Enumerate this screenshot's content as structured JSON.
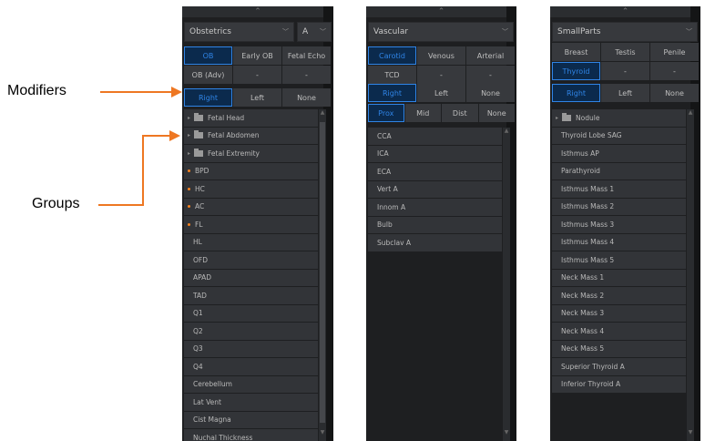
{
  "annotations": {
    "modifiers": "Modifiers",
    "groups": "Groups"
  },
  "colors": {
    "accent_blue": "#2f84e6",
    "arrow_orange": "#ee7722",
    "dot_orange": "#f5821f",
    "panel_bg": "#1e1f21"
  },
  "icons": {
    "collapse_up": "⌃",
    "collapse_side": "«",
    "scroll_up": "▲",
    "scroll_down": "▼",
    "caret": "▸"
  },
  "panel1": {
    "exam": "Obstetrics",
    "side_select": "A",
    "row1": [
      "OB",
      "Early OB",
      "Fetal Echo"
    ],
    "row2": [
      "OB (Adv)",
      "-",
      "-"
    ],
    "modifiers": [
      "Right",
      "Left",
      "None"
    ],
    "groups": [
      "Fetal Head",
      "Fetal Abdomen",
      "Fetal Extremity"
    ],
    "items_dot": [
      "BPD",
      "HC",
      "AC",
      "FL"
    ],
    "items": [
      "HL",
      "OFD",
      "APAD",
      "TAD",
      "Q1",
      "Q2",
      "Q3",
      "Q4",
      "Cerebellum",
      "Lat Vent",
      "Cist Magna",
      "Nuchal Thickness"
    ]
  },
  "panel2": {
    "exam": "Vascular",
    "row1": [
      "Carotid",
      "Venous",
      "Arterial"
    ],
    "row2": [
      "TCD",
      "-",
      "-"
    ],
    "modifiers": [
      "Right",
      "Left",
      "None"
    ],
    "modifiers2": [
      "Prox",
      "Mid",
      "Dist",
      "None"
    ],
    "items": [
      "CCA",
      "ICA",
      "ECA",
      "Vert A",
      "Innom A",
      "Bulb",
      "Subclav A"
    ]
  },
  "panel3": {
    "exam": "SmallParts",
    "row1": [
      "Breast",
      "Testis",
      "Penile"
    ],
    "row2": [
      "Thyroid",
      "-",
      "-"
    ],
    "modifiers": [
      "Right",
      "Left",
      "None"
    ],
    "groups": [
      "Nodule"
    ],
    "items": [
      "Thyroid Lobe SAG",
      "Isthmus AP",
      "Parathyroid",
      "Isthmus Mass 1",
      "Isthmus Mass 2",
      "Isthmus Mass 3",
      "Isthmus Mass 4",
      "Isthmus Mass 5",
      "Neck Mass 1",
      "Neck Mass 2",
      "Neck Mass 3",
      "Neck Mass 4",
      "Neck Mass 5",
      "Superior Thyroid A",
      "Inferior Thyroid A"
    ]
  }
}
